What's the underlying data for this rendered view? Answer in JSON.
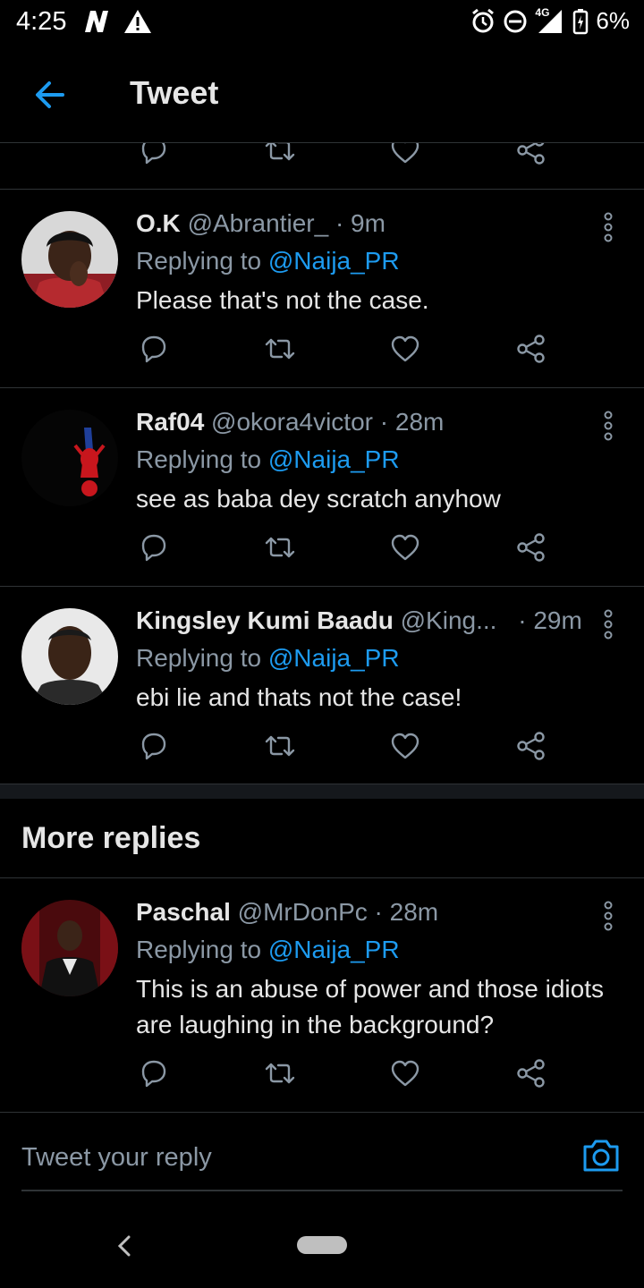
{
  "status_bar": {
    "time": "4:25",
    "network": "4G",
    "battery": "6%",
    "icons": [
      "netflix-n-icon",
      "warning-icon",
      "alarm-icon",
      "dnd-icon",
      "signal-icon",
      "battery-icon"
    ]
  },
  "header": {
    "title": "Tweet",
    "back_icon": "arrow-left-icon"
  },
  "tweets": [
    {
      "name": "O.K",
      "handle": "@Abrantier_",
      "time": "· 9m",
      "replying_prefix": "Replying to",
      "replying_to": "@Naija_PR",
      "text": "Please that's not the case."
    },
    {
      "name": "Raf04",
      "handle": "@okora4victor",
      "time": "· 28m",
      "replying_prefix": "Replying to",
      "replying_to": "@Naija_PR",
      "text": "see as baba dey scratch anyhow"
    },
    {
      "name": "Kingsley Kumi Baadu",
      "handle": "@King...",
      "time": "· 29m",
      "replying_prefix": "Replying to",
      "replying_to": "@Naija_PR",
      "text": "ebi lie and thats not the case!"
    }
  ],
  "more_replies": {
    "title": "More replies",
    "tweets": [
      {
        "name": "Paschal",
        "handle": "@MrDonPc",
        "time": "· 28m",
        "replying_prefix": "Replying to",
        "replying_to": "@Naija_PR",
        "text": "This is an abuse of power and those idiots are laughing in the background?"
      }
    ]
  },
  "composer": {
    "placeholder": "Tweet your reply",
    "camera_icon": "camera-icon"
  },
  "colors": {
    "background": "#000000",
    "accent": "#1d9bf0",
    "secondary_text": "#8b98a5",
    "divider": "#2f3336"
  }
}
